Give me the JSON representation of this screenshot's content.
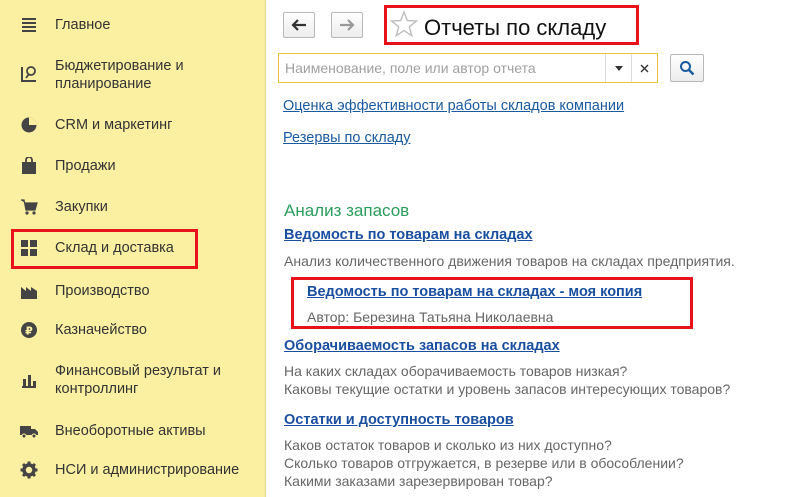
{
  "sidebar": {
    "items": [
      {
        "label": "Главное",
        "icon": "menu-lines-icon"
      },
      {
        "label": "Бюджетирование и",
        "label2": "планирование",
        "icon": "budget-chart-icon"
      },
      {
        "label": "CRM и маркетинг",
        "icon": "pie-chart-icon"
      },
      {
        "label": "Продажи",
        "icon": "shopping-bag-icon"
      },
      {
        "label": "Закупки",
        "icon": "shopping-cart-icon"
      },
      {
        "label": "Склад и доставка",
        "icon": "warehouse-grid-icon"
      },
      {
        "label": "Производство",
        "icon": "factory-icon"
      },
      {
        "label": "Казначейство",
        "icon": "ruble-coin-icon"
      },
      {
        "label": "Финансовый результат и",
        "label2": "контроллинг",
        "icon": "bar-chart-icon"
      },
      {
        "label": "Внеоборотные активы",
        "icon": "truck-icon"
      },
      {
        "label": "НСИ и администрирование",
        "icon": "gear-icon"
      }
    ]
  },
  "header": {
    "title": "Отчеты по складу",
    "back_icon": "arrow-left-icon",
    "forward_icon": "arrow-right-icon",
    "favorite_icon": "star-icon"
  },
  "search": {
    "placeholder": "Наименование, поле или автор отчета",
    "value": "",
    "dropdown_icon": "triangle-down-icon",
    "clear_icon": "close-icon",
    "find_icon": "search-icon"
  },
  "links_top": [
    "Оценка эффективности работы складов компании",
    "Резервы по складу"
  ],
  "section": {
    "title": "Анализ запасов",
    "reports": [
      {
        "title": "Ведомость по товарам на складах",
        "desc": [
          "Анализ количественного движения товаров на складах предприятия."
        ]
      },
      {
        "title": "Ведомость по товарам на складах - моя копия",
        "desc": [
          "Автор: Березина Татьяна Николаевна"
        ]
      },
      {
        "title": "Оборачиваемость запасов на складах",
        "desc": [
          "На каких складах оборачиваемость товаров низкая?",
          "Каковы текущие остатки и уровень запасов интересующих товаров?"
        ]
      },
      {
        "title": "Остатки и доступность товаров",
        "desc": [
          "Каков остаток товаров и сколько из них доступно?",
          "Сколько товаров отгружается, в резерве или в обособлении?",
          "Какими заказами зарезервирован товар?"
        ]
      }
    ]
  },
  "colors": {
    "sidebar_bg": "#fbf0a2",
    "link": "#1a5aa0",
    "section_title": "#2a9d5c",
    "highlight": "#e8121b",
    "search_border": "#f0c040"
  }
}
